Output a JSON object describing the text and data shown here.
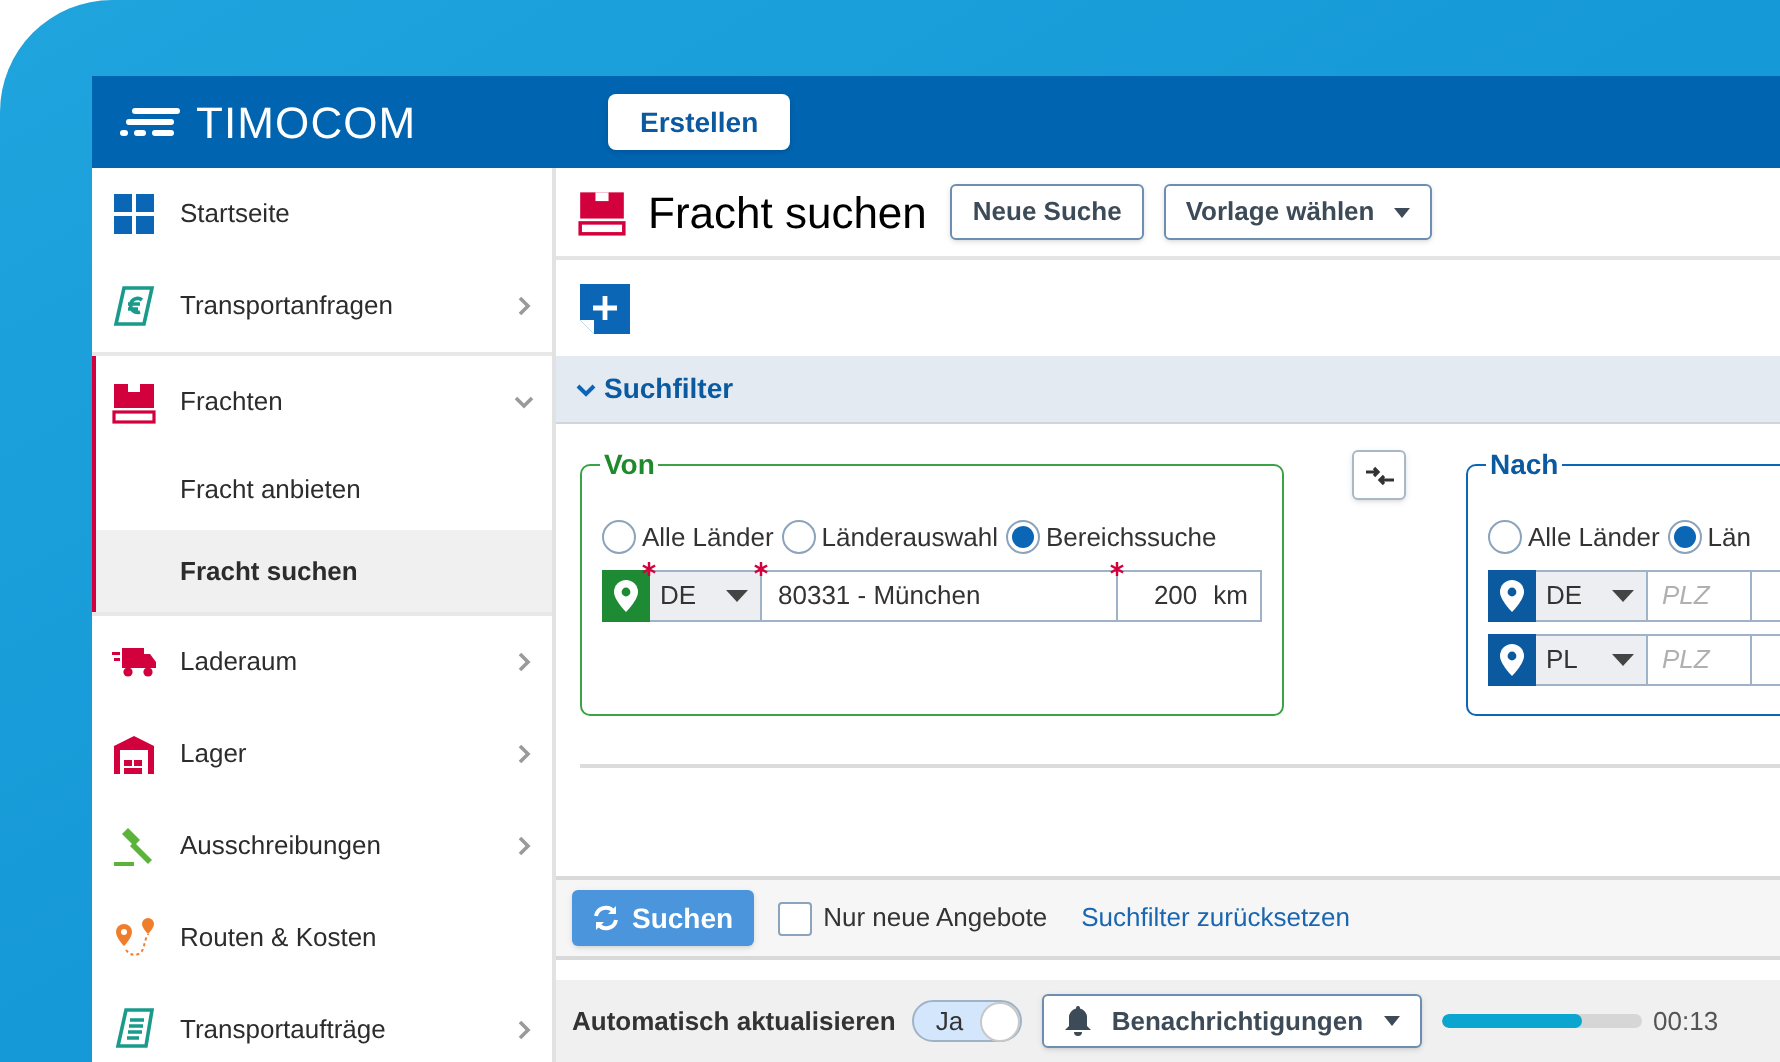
{
  "header": {
    "logo": "TIMOCOM",
    "create_button": "Erstellen"
  },
  "sidebar": {
    "items": [
      {
        "label": "Startseite",
        "kind": "link",
        "selected": false
      },
      {
        "label": "Transportanfragen",
        "kind": "group",
        "expanded": false,
        "selected": false
      },
      {
        "label": "Frachten",
        "kind": "group",
        "expanded": true,
        "selected": true,
        "children": [
          {
            "label": "Fracht anbieten",
            "selected": false
          },
          {
            "label": "Fracht suchen",
            "selected": true
          }
        ]
      },
      {
        "label": "Laderaum",
        "kind": "group",
        "expanded": false,
        "selected": false
      },
      {
        "label": "Lager",
        "kind": "group",
        "expanded": false,
        "selected": false
      },
      {
        "label": "Ausschreibungen",
        "kind": "group",
        "expanded": false,
        "selected": false
      },
      {
        "label": "Routen & Kosten",
        "kind": "link",
        "selected": false
      },
      {
        "label": "Transportaufträge",
        "kind": "group",
        "expanded": false,
        "selected": false
      }
    ]
  },
  "page": {
    "title": "Fracht suchen",
    "buttons": [
      {
        "label": "Neue Suche",
        "dropdown": false
      },
      {
        "label": "Vorlage wählen",
        "dropdown": true
      }
    ]
  },
  "filter": {
    "title": "Suchfilter",
    "expanded": true,
    "from": {
      "legend": "Von",
      "options": [
        {
          "label": "Alle Länder",
          "selected": false
        },
        {
          "label": "Länderauswahl",
          "selected": false
        },
        {
          "label": "Bereichssuche",
          "selected": true
        }
      ],
      "rows": [
        {
          "country": "DE",
          "location": "80331 - München",
          "radius": "200",
          "unit": "km"
        }
      ]
    },
    "to": {
      "legend": "Nach",
      "options": [
        {
          "label": "Alle Länder",
          "selected": false
        },
        {
          "label": "Län",
          "selected": true
        }
      ],
      "rows": [
        {
          "country": "DE",
          "placeholder": "PLZ"
        },
        {
          "country": "PL",
          "placeholder": "PLZ"
        }
      ]
    }
  },
  "actions": {
    "search_button": "Suchen",
    "only_new": {
      "label": "Nur neue Angebote",
      "checked": false
    },
    "reset_link": "Suchfilter zurücksetzen"
  },
  "status_bar": {
    "auto_update": {
      "label": "Automatisch aktualisieren",
      "toggle_label": "Ja",
      "on": true
    },
    "notifications": "Benachrichtigungen",
    "countdown": {
      "level": 0.7,
      "reading": "00:13"
    }
  }
}
